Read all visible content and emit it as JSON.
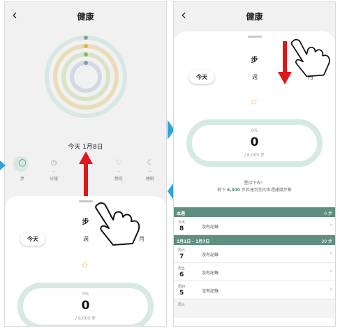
{
  "app_title": "健康",
  "back_icon": "chevron-left-icon",
  "colors": {
    "accent": "#5f8f80",
    "ring": "#d6e9e4",
    "arrow": "#e0161c",
    "star": "#e0b43a",
    "pointer": "#2ea3dc"
  },
  "left": {
    "date_line": "今天 1月8日",
    "stats": [
      {
        "icon": "steps-icon",
        "value": "-",
        "unit": "步"
      },
      {
        "icon": "timer-icon",
        "value": "-",
        "unit": "分鐘"
      },
      {
        "icon": "flame-icon",
        "value": "-",
        "unit": ""
      },
      {
        "icon": "heart-icon",
        "value": "-",
        "unit": "靜息"
      },
      {
        "icon": "moon-icon",
        "value": "-:-",
        "unit": "睡眠"
      }
    ],
    "sheet": {
      "title": "步",
      "tabs": [
        "今天",
        "週",
        "月"
      ],
      "selected_tab": "今天",
      "percent": "0%",
      "value": "0",
      "goal": "/ 6,000 步"
    }
  },
  "right": {
    "sheet": {
      "title": "步",
      "tabs": [
        "今天",
        "週",
        "月"
      ],
      "selected_tab": "今天",
      "percent": "0%",
      "value": "0",
      "goal": "/ 6,000 步",
      "message_line1": "堅持下去！",
      "message_line2_pre": "剩下 ",
      "message_line2_bold": "6,000",
      "message_line2_post": " 步就達到您的本週建議步數"
    },
    "groups": [
      {
        "label": "本週",
        "total": "0 步",
        "rows": [
          {
            "day": "今天",
            "date": "8",
            "desc": "沒有記錄"
          }
        ]
      },
      {
        "label": "1月1日 - 1月7日",
        "total": "20 步",
        "rows": [
          {
            "day": "周六",
            "date": "7",
            "desc": "沒有記錄"
          },
          {
            "day": "周五",
            "date": "6",
            "desc": "沒有記錄"
          },
          {
            "day": "周四",
            "date": "5",
            "desc": "沒有記錄"
          }
        ]
      }
    ],
    "last_row_day": "周三"
  }
}
